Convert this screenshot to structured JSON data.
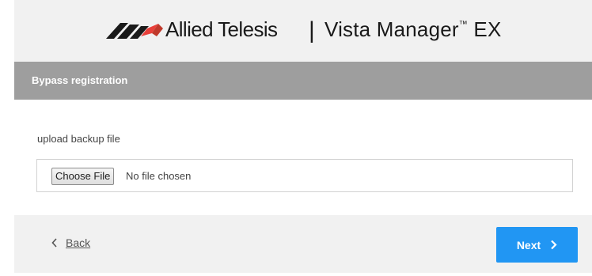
{
  "header": {
    "brand": "Allied Telesis",
    "separator": "|",
    "product": "Vista Manager",
    "trademark": "™",
    "product_suffix": " EX",
    "logo_icon": "allied-telesis-logo-icon",
    "brand_colors": {
      "logo_dark": "#1a1a1a",
      "logo_accent": "#e8403a"
    }
  },
  "panel": {
    "title": "Bypass registration",
    "field_label": "upload backup file",
    "file_input": {
      "button_label": "Choose File",
      "status": "No file chosen"
    }
  },
  "footer": {
    "back_icon": "chevron-left-icon",
    "back_label": "Back",
    "next_label": "Next",
    "next_icon": "chevron-right-icon",
    "accent_color": "#2196f3"
  }
}
